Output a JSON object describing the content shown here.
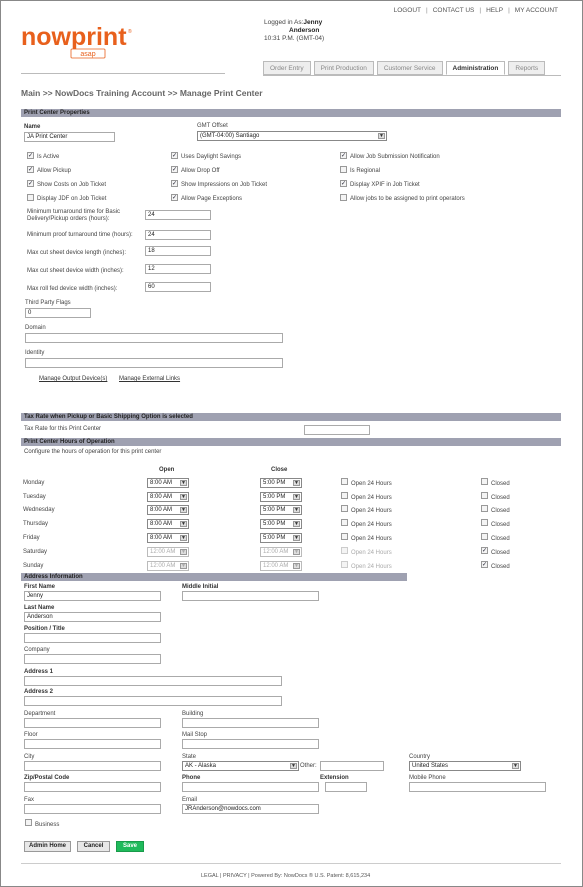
{
  "top_links": [
    "LOGOUT",
    "CONTACT US",
    "HELP",
    "MY ACCOUNT"
  ],
  "logo": {
    "brand": "nowprint",
    "sub": "asap",
    "brand_color": "#e8601c"
  },
  "login": {
    "prefix": "Logged in As:",
    "first": "Jenny",
    "last": "Anderson",
    "time": "10:31 P.M. (GMT-04)"
  },
  "tabs": [
    "Order Entry",
    "Print Production",
    "Customer Service",
    "Administration",
    "Reports"
  ],
  "active_tab": "Administration",
  "breadcrumb": "Main >> NowDocs Training Account >> Manage Print Center",
  "pc": {
    "section": "Print Center Properties",
    "name_label": "Name",
    "name_value": "JA Print Center",
    "gmt_label": "GMT Offset",
    "gmt_value": "(GMT-04:00) Santiago",
    "checks": [
      {
        "label": "Is Active",
        "checked": true
      },
      {
        "label": "Uses Daylight Savings",
        "checked": true
      },
      {
        "label": "Allow Job Submission Notification",
        "checked": true
      },
      {
        "label": "Allow Pickup",
        "checked": true
      },
      {
        "label": "Allow Drop Off",
        "checked": true
      },
      {
        "label": "Is Regional",
        "checked": false
      },
      {
        "label": "Show Costs on Job Ticket",
        "checked": true
      },
      {
        "label": "Show Impressions on Job Ticket",
        "checked": true
      },
      {
        "label": "Display XPIF in Job Ticket",
        "checked": true
      },
      {
        "label": "Display JDF on Job Ticket",
        "checked": false
      },
      {
        "label": "Allow Page Exceptions",
        "checked": true
      },
      {
        "label": "Allow jobs to be assigned to print operators",
        "checked": false
      }
    ],
    "fields": [
      {
        "label": "Minimum turnaround time for Basic",
        "label2": "Delivery/Pickup orders (hours):",
        "value": "24"
      },
      {
        "label": "Minimum proof turnaround time (hours):",
        "value": "24"
      },
      {
        "label": "Max cut sheet device length (inches):",
        "value": "18"
      },
      {
        "label": "Max cut sheet device width (inches):",
        "value": "12"
      },
      {
        "label": "Max roll fed device width (inches):",
        "value": "60"
      }
    ],
    "tpf_label": "Third Party Flags",
    "tpf_value": "0",
    "domain_label": "Domain",
    "domain_value": "",
    "identity_label": "Identity",
    "identity_value": "",
    "link_output": "Manage Output Device(s)",
    "link_external": "Manage External Links"
  },
  "tax": {
    "section": "Tax Rate when Pickup or Basic Shipping Option is selected",
    "label": "Tax Rate for this Print Center",
    "value": ""
  },
  "hours": {
    "section": "Print Center Hours of Operation",
    "desc": "Configure the hours of operation for this print center",
    "open_header": "Open",
    "close_header": "Close",
    "open24_label": "Open 24 Hours",
    "closed_label": "Closed",
    "days": [
      {
        "day": "Monday",
        "open": "8:00 AM",
        "close": "5:00 PM",
        "open24": false,
        "closed": false
      },
      {
        "day": "Tuesday",
        "open": "8:00 AM",
        "close": "5:00 PM",
        "open24": false,
        "closed": false
      },
      {
        "day": "Wednesday",
        "open": "8:00 AM",
        "close": "5:00 PM",
        "open24": false,
        "closed": false
      },
      {
        "day": "Thursday",
        "open": "8:00 AM",
        "close": "5:00 PM",
        "open24": false,
        "closed": false
      },
      {
        "day": "Friday",
        "open": "8:00 AM",
        "close": "5:00 PM",
        "open24": false,
        "closed": false
      },
      {
        "day": "Saturday",
        "open": "12:00 AM",
        "close": "12:00 AM",
        "open24": false,
        "closed": true
      },
      {
        "day": "Sunday",
        "open": "12:00 AM",
        "close": "12:00 AM",
        "open24": false,
        "closed": true
      }
    ]
  },
  "addr": {
    "section": "Address Information",
    "first_name_label": "First Name",
    "first_name": "Jenny",
    "middle_label": "Middle Initial",
    "middle": "",
    "last_name_label": "Last Name",
    "last_name": "Anderson",
    "position_label": "Position / Title",
    "company_label": "Company",
    "address1_label": "Address 1",
    "address2_label": "Address 2",
    "department_label": "Department",
    "building_label": "Building",
    "floor_label": "Floor",
    "mailstop_label": "Mail Stop",
    "city_label": "City",
    "state_label": "State",
    "state_value": "AK - Alaska",
    "other_label": "Other:",
    "country_label": "Country",
    "country_value": "United States",
    "zip_label": "Zip/Postal Code",
    "phone_label": "Phone",
    "extension_label": "Extension",
    "mobile_label": "Mobile Phone",
    "fax_label": "Fax",
    "email_label": "Email",
    "email_value": "JRAnderson@nowdocs.com",
    "business_label": "Business"
  },
  "buttons": {
    "admin_home": "Admin Home",
    "cancel": "Cancel",
    "save": "Save"
  },
  "footer": "LEGAL   |  PRIVACY   |  Powered By: NowDocs ® U.S. Patent: 8,615,234"
}
